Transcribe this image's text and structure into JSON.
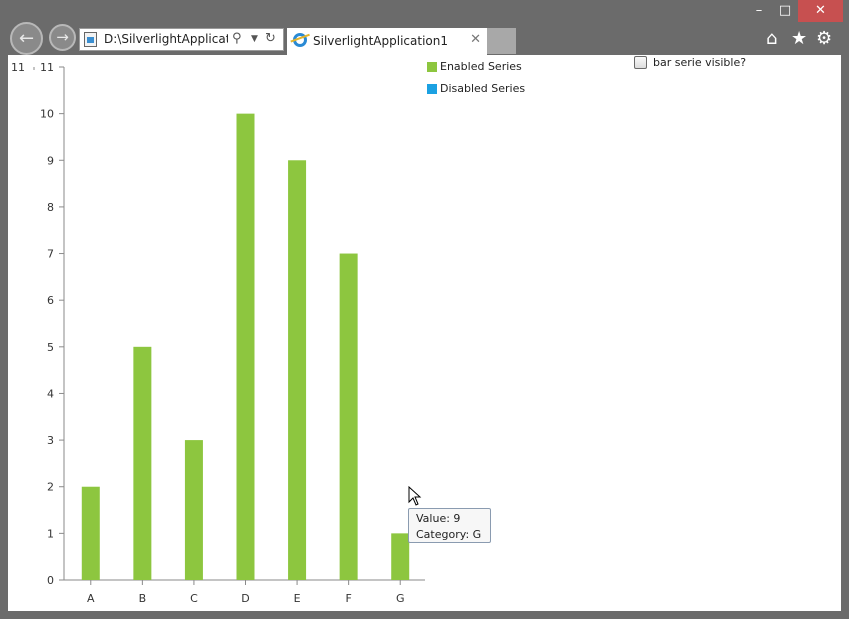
{
  "window": {
    "minimize": "–",
    "maximize": "□",
    "close": "✕"
  },
  "browser": {
    "address": "D:\\SilverlightApplicatio",
    "tab_title": "SilverlightApplication1",
    "tab_close": "✕",
    "icons": [
      "back-arrow-icon",
      "forward-arrow-icon",
      "search-icon",
      "dropdown-icon",
      "refresh-icon",
      "home-icon",
      "star-icon",
      "gear-icon"
    ]
  },
  "page": {
    "checkbox_label": "bar serie visible?",
    "checkbox_checked": false,
    "legend": [
      {
        "label": "Enabled Series",
        "color": "#8dc63f"
      },
      {
        "label": "Disabled Series",
        "color": "#1ba1e2"
      }
    ],
    "tooltip": {
      "value_line": "Value: 9",
      "category_line": "Category: G"
    }
  },
  "chart_data": {
    "type": "bar",
    "categories": [
      "A",
      "B",
      "C",
      "D",
      "E",
      "F",
      "G"
    ],
    "series": [
      {
        "name": "Enabled Series",
        "values": [
          2,
          5,
          3,
          10,
          9,
          7,
          1
        ],
        "color": "#8dc63f"
      }
    ],
    "ylim": [
      0,
      11
    ],
    "yticks": [
      0,
      1,
      2,
      3,
      4,
      5,
      6,
      7,
      8,
      9,
      10,
      11
    ],
    "secondary_axis_ticks": [
      11
    ],
    "grid": false,
    "legend_position": "top-right"
  }
}
